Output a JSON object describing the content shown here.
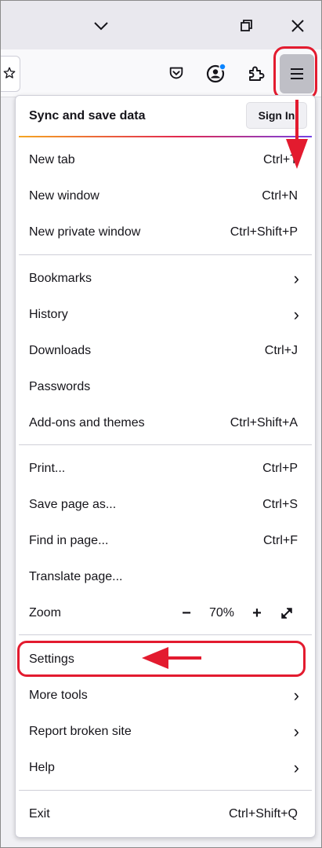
{
  "window": {
    "minimize_icon": "chevron-down-icon",
    "restore_icon": "restore-icon",
    "close_icon": "close-icon"
  },
  "toolbar": {
    "icons": [
      "bookmark-star-icon",
      "pocket-icon",
      "account-icon",
      "extensions-icon",
      "hamburger-menu-icon"
    ]
  },
  "menu": {
    "sync": {
      "title": "Sync and save data",
      "sign_in": "Sign In"
    },
    "group1": [
      {
        "label": "New tab",
        "shortcut": "Ctrl+T"
      },
      {
        "label": "New window",
        "shortcut": "Ctrl+N"
      },
      {
        "label": "New private window",
        "shortcut": "Ctrl+Shift+P"
      }
    ],
    "group2": [
      {
        "label": "Bookmarks",
        "shortcut": ""
      },
      {
        "label": "History",
        "shortcut": ""
      },
      {
        "label": "Downloads",
        "shortcut": "Ctrl+J"
      },
      {
        "label": "Passwords",
        "shortcut": ""
      },
      {
        "label": "Add-ons and themes",
        "shortcut": "Ctrl+Shift+A"
      }
    ],
    "group3": [
      {
        "label": "Print...",
        "shortcut": "Ctrl+P"
      },
      {
        "label": "Save page as...",
        "shortcut": "Ctrl+S"
      },
      {
        "label": "Find in page...",
        "shortcut": "Ctrl+F"
      },
      {
        "label": "Translate page...",
        "shortcut": ""
      }
    ],
    "zoom": {
      "label": "Zoom",
      "minus": "−",
      "value": "70%",
      "plus": "+"
    },
    "group4": [
      {
        "label": "Settings",
        "shortcut": ""
      },
      {
        "label": "More tools",
        "shortcut": ""
      },
      {
        "label": "Report broken site",
        "shortcut": ""
      },
      {
        "label": "Help",
        "shortcut": ""
      }
    ],
    "exit": {
      "label": "Exit",
      "shortcut": "Ctrl+Shift+Q"
    }
  },
  "colors": {
    "annotation_red": "#e31b2f",
    "account_badge": "#0a84ff"
  }
}
